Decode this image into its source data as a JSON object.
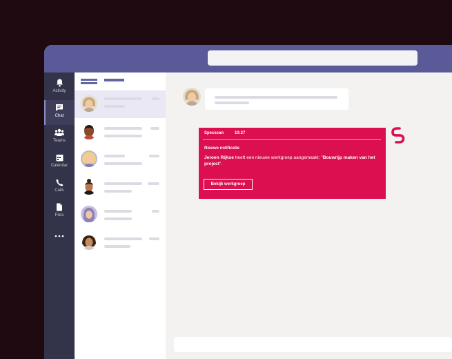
{
  "rail": {
    "items": [
      {
        "label": "Activity",
        "icon": "bell-icon"
      },
      {
        "label": "Chat",
        "icon": "chat-icon"
      },
      {
        "label": "Teams",
        "icon": "teams-icon"
      },
      {
        "label": "Calendar",
        "icon": "calendar-icon"
      },
      {
        "label": "Calls",
        "icon": "phone-icon"
      },
      {
        "label": "Files",
        "icon": "file-icon"
      }
    ],
    "more_icon": "more-dots-icon"
  },
  "notification": {
    "app": "Specscan",
    "time": "10:27",
    "heading": "Nieuwe notificatie",
    "body_name": "Jeroen Rijkse",
    "body_text": " heeft een nieuwe werkgroep aangemaakt: \"",
    "body_group": "Bouwrijp maken van het project",
    "body_end": "\".",
    "button_label": "Bekijk werkgroep"
  },
  "colors": {
    "topbar": "#5b5a98",
    "rail": "#33344a",
    "accent": "#6264a7",
    "card": "#dc0f50",
    "background": "#1f0a12"
  }
}
